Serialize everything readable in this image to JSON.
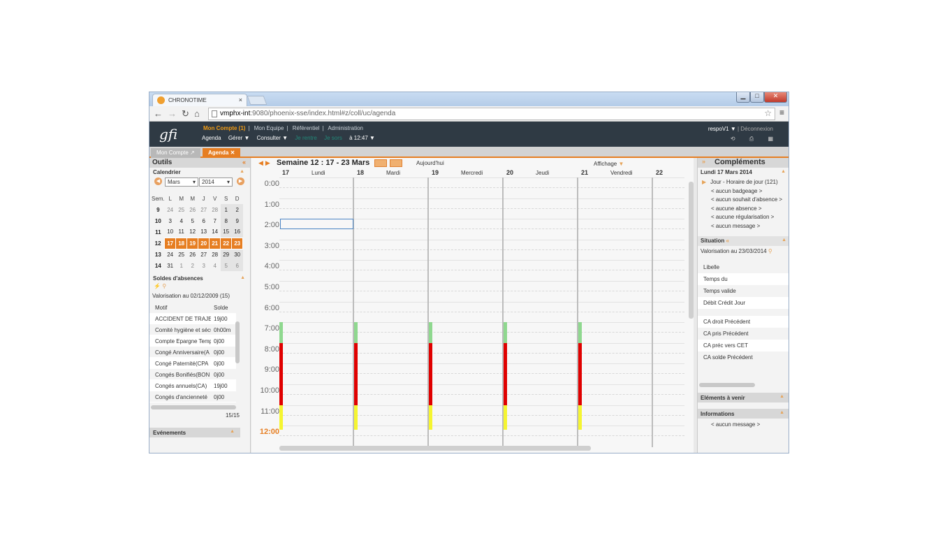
{
  "browser": {
    "tab_title": "CHRONOTIME",
    "tab_close": "×",
    "url_host": "vmphx-int",
    "url_rest": ":9080/phoenix-sse/index.html#z/coll/uc/agenda"
  },
  "header": {
    "logo": "gfi",
    "menu": [
      "Mon Compte (1)",
      "Mon Equipe",
      "Référentiel",
      "Administration"
    ],
    "menu_sep": "|",
    "submenu": [
      "Agenda",
      "Gérer ▼",
      "Consulter ▼",
      "Je rentre",
      "Je sors",
      "à 12:47 ▼"
    ],
    "user": "respoV1",
    "logout": "Déconnexion"
  },
  "app_tabs": [
    "Mon Compte",
    "Agenda"
  ],
  "left": {
    "title": "Outils",
    "calendar": {
      "title": "Calendrier",
      "month": "Mars",
      "year": "2014",
      "head": [
        "Sem.",
        "L",
        "M",
        "M",
        "J",
        "V",
        "S",
        "D"
      ],
      "weeks": [
        [
          "9",
          "24",
          "25",
          "26",
          "27",
          "28",
          "1",
          "2"
        ],
        [
          "10",
          "3",
          "4",
          "5",
          "6",
          "7",
          "8",
          "9"
        ],
        [
          "11",
          "10",
          "11",
          "12",
          "13",
          "14",
          "15",
          "16"
        ],
        [
          "12",
          "17",
          "18",
          "19",
          "20",
          "21",
          "22",
          "23"
        ],
        [
          "13",
          "24",
          "25",
          "26",
          "27",
          "28",
          "29",
          "30"
        ],
        [
          "14",
          "31",
          "1",
          "2",
          "3",
          "4",
          "5",
          "6"
        ]
      ]
    },
    "soldes": {
      "title": "Soldes d'absences",
      "valo": "Valorisation au 02/12/2009 (15)",
      "col_motif": "Motif",
      "col_solde": "Solde",
      "rows": [
        {
          "motif": "ACCIDENT DE TRAJET",
          "solde": "19j00"
        },
        {
          "motif": "Comité hygiène et sécurité",
          "solde": "0h00m"
        },
        {
          "motif": "Compte Epargne Temps",
          "solde": "0j00"
        },
        {
          "motif": "Congé Anniversaire(A",
          "solde": "0j00"
        },
        {
          "motif": "Congé Paternité(CPA",
          "solde": "0j00"
        },
        {
          "motif": "Congés Bonifiés(BON",
          "solde": "0j00"
        },
        {
          "motif": "Congés annuels(CA)",
          "solde": "19j00"
        },
        {
          "motif": "Congés d'ancienneté",
          "solde": "0j00"
        }
      ],
      "pager": "15/15"
    },
    "events_title": "Evénements"
  },
  "center": {
    "week_title": "Semaine 12 : 17 - 23 Mars",
    "today": "Aujourd'hui",
    "display": "Affichage",
    "days": [
      {
        "num": "17",
        "name": "Lundi"
      },
      {
        "num": "18",
        "name": "Mardi"
      },
      {
        "num": "19",
        "name": "Mercredi"
      },
      {
        "num": "20",
        "name": "Jeudi"
      },
      {
        "num": "21",
        "name": "Vendredi"
      },
      {
        "num": "22",
        "name": ""
      }
    ],
    "hours": [
      "0:00",
      "1:00",
      "2:00",
      "3:00",
      "4:00",
      "5:00",
      "6:00",
      "7:00",
      "8:00",
      "9:00",
      "10:00",
      "11:00",
      "12:00"
    ],
    "colors": {
      "green": "#8fd88f",
      "red": "#e00000",
      "yellow": "#f5f530"
    }
  },
  "right": {
    "title": "Compléments",
    "day_title": "Lundi 17 Mars 2014",
    "day_lines": [
      "Jour - Horaire de jour (121)",
      "< aucun badgeage >",
      "< aucun souhait d'absence >",
      "< aucune absence >",
      "< aucune régularisation >",
      "< aucun message >"
    ],
    "situation": "Situation",
    "valo": "Valorisation au 23/03/2014",
    "sit_rows_a": [
      "Libelle",
      "Temps du",
      "Temps valide",
      "Débit Crédit Jour"
    ],
    "sit_rows_b": [
      "CA droit Précédent",
      "CA pris Précédent",
      "CA préc vers CET",
      "CA solde Précédent"
    ],
    "elements": "Eléments à venir",
    "informations": "Informations",
    "info_msg": "< aucun message >"
  }
}
